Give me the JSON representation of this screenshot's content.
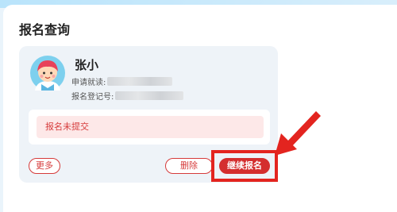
{
  "page": {
    "title": "报名查询"
  },
  "registration": {
    "name": "张小",
    "school_label": "申请就读:",
    "reg_no_label": "报名登记号:",
    "status_text": "报名未提交"
  },
  "actions": {
    "more_label": "更多",
    "delete_label": "删除",
    "continue_label": "继续报名"
  },
  "colors": {
    "accent_red": "#d42e2e",
    "status_bg": "#fde8e8",
    "card_bg": "#eef3f8",
    "annotation_red": "#e3241f"
  },
  "icons": {
    "avatar": "child-avatar-icon",
    "annotation": "red-arrow-icon"
  }
}
